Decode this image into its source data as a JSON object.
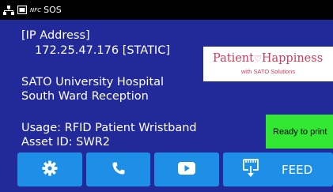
{
  "status_bar": {
    "icons": [
      "network-icon",
      "sim-card-icon",
      "nfc-icon"
    ],
    "nfc_label": "NFC",
    "sos_label": "SOS"
  },
  "info": {
    "ip_label": "[IP Address]",
    "ip_value": "172.25.47.176 [STATIC]",
    "site_line1": "SATO University Hospital",
    "site_line2": "South Ward Reception",
    "usage": "Usage: RFID Patient Wristband",
    "asset_id": "Asset ID: SWR2"
  },
  "logo": {
    "main_left": "Patient",
    "main_right": "Happiness",
    "sub": "with SATO Solutions"
  },
  "status_badge": {
    "text": "Ready to print"
  },
  "buttons": {
    "settings_icon": "gear-icon",
    "phone_icon": "phone-icon",
    "video_icon": "play-icon",
    "feed_icon": "feed-icon",
    "feed_label": "FEED"
  },
  "colors": {
    "background": "#222a99",
    "button": "#1e8fe6",
    "badge": "#33e833",
    "logo_text": "#d03a5a"
  }
}
